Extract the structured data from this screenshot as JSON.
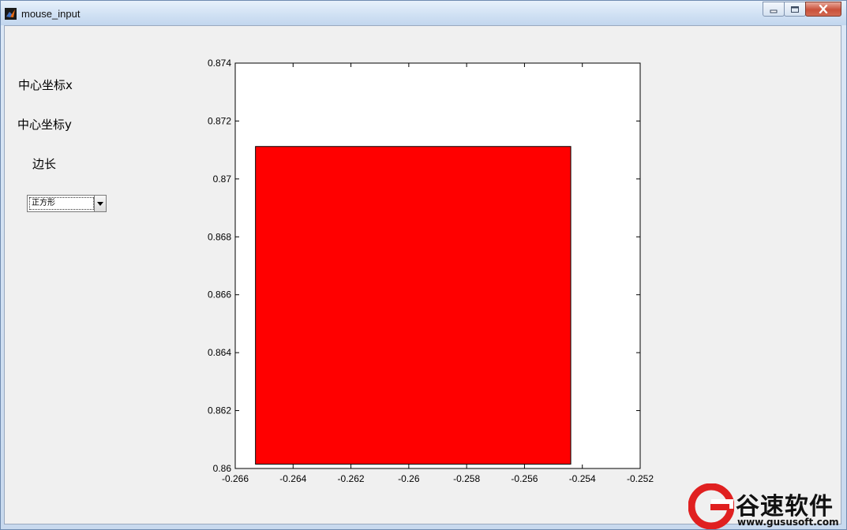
{
  "window": {
    "title": "mouse_input",
    "app_icon": "matlab-icon",
    "buttons": [
      "minimize-icon",
      "maximize-icon",
      "close-icon"
    ]
  },
  "panel": {
    "label_center_x": "中心坐标x",
    "label_center_y": "中心坐标y",
    "label_side": "边长",
    "shape_select": {
      "value": "正方形",
      "icon": "chevron-down-icon"
    }
  },
  "colors": {
    "square_fill": "#ff0000",
    "axes_bg": "#ffffff",
    "figure_bg": "#f0f0f0"
  },
  "chart_data": {
    "type": "area",
    "shape": "rectangle",
    "x": [
      -0.2653,
      -0.2544
    ],
    "y": [
      0.86015,
      0.87112
    ],
    "xlim": [
      -0.266,
      -0.252
    ],
    "ylim": [
      0.86,
      0.874
    ],
    "xticks": [
      -0.266,
      -0.264,
      -0.262,
      -0.26,
      -0.258,
      -0.256,
      -0.254,
      -0.252
    ],
    "yticks": [
      0.86,
      0.862,
      0.864,
      0.866,
      0.868,
      0.87,
      0.872,
      0.874
    ],
    "xtick_labels": [
      "-0.266",
      "-0.264",
      "-0.262",
      "-0.26",
      "-0.258",
      "-0.256",
      "-0.254",
      "-0.252"
    ],
    "ytick_labels": [
      "0.86",
      "0.862",
      "0.864",
      "0.866",
      "0.868",
      "0.87",
      "0.872",
      "0.874"
    ],
    "fill": "#ff0000",
    "edge": "#000000",
    "grid": false
  },
  "watermark": {
    "text": "谷速软件",
    "url": "www.gususoft.com"
  }
}
